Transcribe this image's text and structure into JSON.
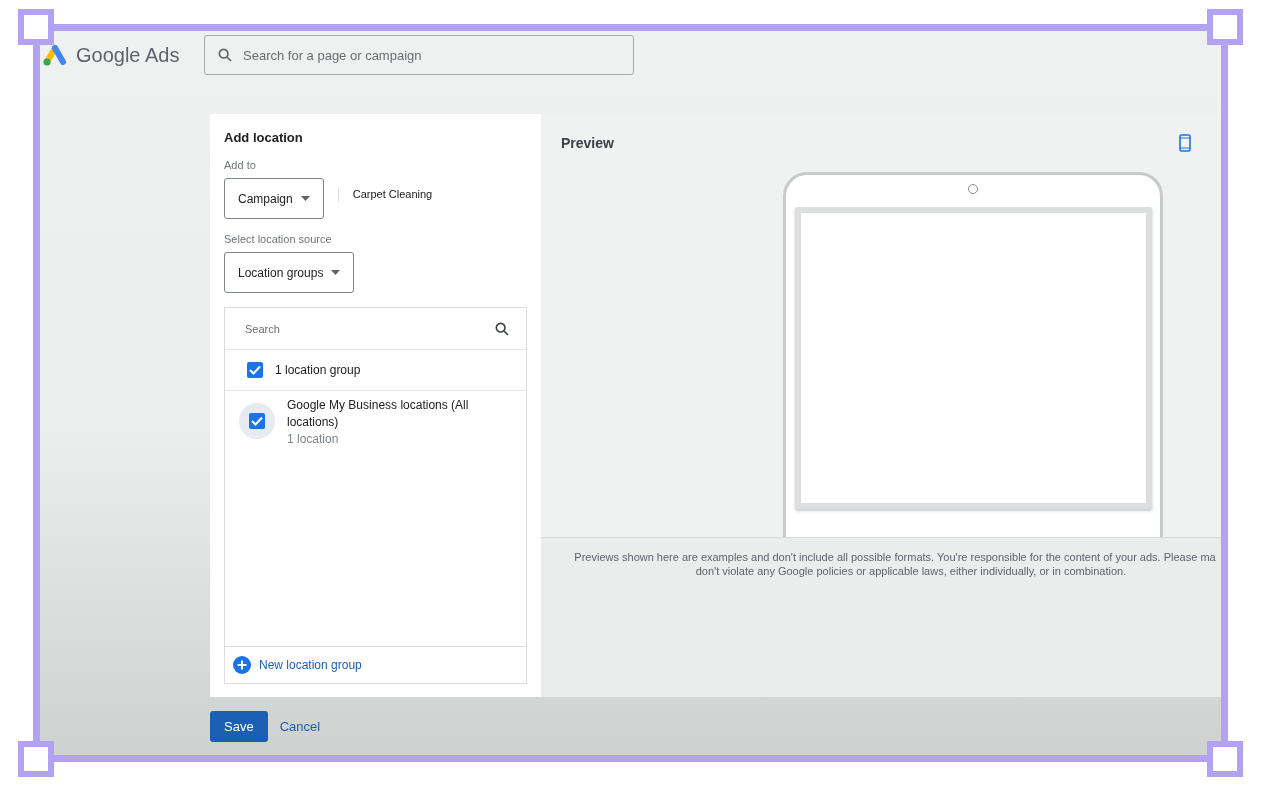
{
  "header": {
    "logo_text": "Google Ads",
    "search_placeholder": "Search for a page or campaign"
  },
  "dialog": {
    "title": "Add location",
    "add_to_label": "Add to",
    "add_to_value": "Campaign",
    "campaign_name": "Carpet Cleaning",
    "source_label": "Select location source",
    "source_value": "Location groups",
    "list": {
      "search_placeholder": "Search",
      "items": [
        {
          "kind": "summary",
          "label": "1 location group",
          "checked": true,
          "focused": false
        },
        {
          "kind": "group",
          "label": "Google My Business locations (All locations)",
          "sublabel": "1 location",
          "checked": true,
          "focused": true
        }
      ]
    },
    "new_group_label": "New location group"
  },
  "preview": {
    "title": "Preview",
    "disclaimer_lines": [
      "Previews shown here are examples and don't include all possible formats. You're responsible for the content of your ads. Please ma",
      "don't violate any Google policies or applicable laws, either individually, or in combination."
    ]
  },
  "buttons": [
    {
      "kind": "primary",
      "label": "Save"
    },
    {
      "kind": "text",
      "label": "Cancel"
    }
  ]
}
